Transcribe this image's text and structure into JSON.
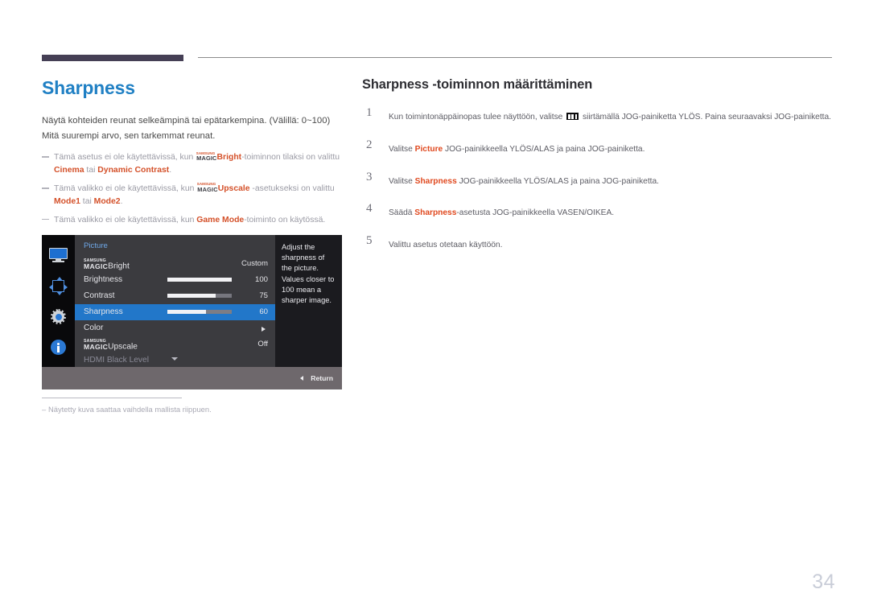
{
  "header": {
    "accent_color": "#453f55",
    "rule_color": "#8c8c8c"
  },
  "left": {
    "title": "Sharpness",
    "title_color": "#2080c4",
    "description_lines": [
      "Näytä kohteiden reunat selkeämpinä tai epätarkempina. (Välillä: 0~100)",
      "Mitä suurempi arvo, sen tarkemmat reunat."
    ],
    "notes": [
      {
        "pre": "Tämä asetus ei ole käytettävissä, kun ",
        "logo": {
          "top": "SAMSUNG",
          "bottom": "MAGIC"
        },
        "emph1": "Bright",
        "mid": "-toiminnon tilaksi on valittu",
        "emph2": "Cinema",
        "conj": " tai ",
        "emph3": "Dynamic Contrast",
        "post": "."
      },
      {
        "pre": "Tämä valikko ei ole käytettävissä, kun ",
        "logo": {
          "top": "SAMSUNG",
          "bottom": "MAGIC"
        },
        "emph1": "Upscale",
        "mid": " -asetukseksi on valittu",
        "emph2": "Mode1",
        "conj": " tai ",
        "emph3": "Mode2",
        "post": "."
      },
      {
        "pre": "Tämä valikko ei ole käytettävissä, kun ",
        "emph1": "Game Mode",
        "mid": "-toiminto on käytössä."
      }
    ],
    "footnote": "Näytetty kuva saattaa vaihdella mallista riippuen."
  },
  "osd": {
    "icons": [
      "monitor-icon",
      "directional-pad-icon",
      "gear-icon",
      "info-icon"
    ],
    "category": "Picture",
    "rows": [
      {
        "label_logo": {
          "top": "SAMSUNG",
          "bottom": "MAGIC"
        },
        "label": "Bright",
        "value": "Custom",
        "type": "value"
      },
      {
        "label": "Brightness",
        "value": "100",
        "type": "slider",
        "fill": 100
      },
      {
        "label": "Contrast",
        "value": "75",
        "type": "slider",
        "fill": 75
      },
      {
        "label": "Sharpness",
        "value": "60",
        "type": "slider",
        "fill": 60,
        "selected": true
      },
      {
        "label": "Color",
        "value": "",
        "type": "submenu"
      },
      {
        "label_logo": {
          "top": "SAMSUNG",
          "bottom": "MAGIC"
        },
        "label": "Upscale",
        "value": "Off",
        "type": "value"
      },
      {
        "label": "HDMI Black Level",
        "value": "",
        "type": "faded"
      }
    ],
    "tooltip": "Adjust the sharpness of the picture. Values closer to 100 mean a sharper image.",
    "return_label": "Return",
    "selected_color": "#2277c9"
  },
  "right": {
    "title": "Sharpness -toiminnon määrittäminen",
    "steps": [
      {
        "num": "1",
        "pre": "Kun toimintonäppäinopas tulee näyttöön, valitse ",
        "icon": "menu-bars-icon",
        "post": " siirtämällä JOG-painiketta YLÖS. Paina seuraavaksi JOG-painiketta."
      },
      {
        "num": "2",
        "pre": "Valitse ",
        "emph": "Picture",
        "post": " JOG-painikkeella YLÖS/ALAS ja paina JOG-painiketta."
      },
      {
        "num": "3",
        "pre": "Valitse ",
        "emph": "Sharpness",
        "post": " JOG-painikkeella YLÖS/ALAS ja paina JOG-painiketta."
      },
      {
        "num": "4",
        "pre": "Säädä ",
        "emph": "Sharpness",
        "post": "-asetusta JOG-painikkeella VASEN/OIKEA."
      },
      {
        "num": "5",
        "pre": "Valittu asetus otetaan käyttöön.",
        "emph": "",
        "post": ""
      }
    ],
    "emph_color": "#e0491f"
  },
  "page_number": "34"
}
